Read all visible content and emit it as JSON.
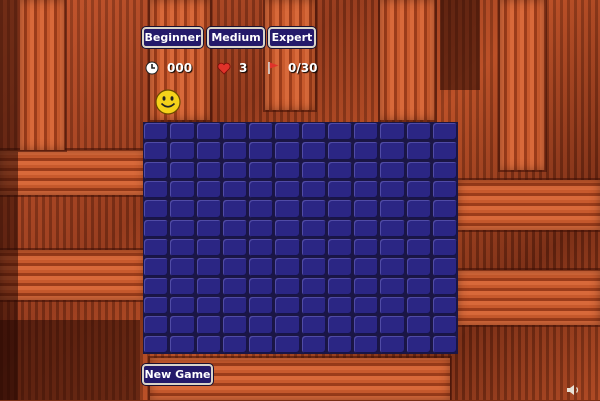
{
  "difficulty": {
    "beginner_label": "Beginner",
    "medium_label": "Medium",
    "expert_label": "Expert"
  },
  "status": {
    "timer": "000",
    "lives": "3",
    "flags": "0/30",
    "timer_icon": "clock-icon",
    "lives_icon": "heart-icon",
    "flags_icon": "flag-icon"
  },
  "smiley_icon": "smiley-face-icon",
  "board": {
    "rows": 12,
    "columns": 12
  },
  "new_game_label": "New Game",
  "sound_icon": "speaker-icon",
  "colors": {
    "button_bg": "#241a6a",
    "cell": "#2b2684",
    "heart": "#e0322a",
    "flag": "#e0322a",
    "smiley": "#f5d21a"
  }
}
